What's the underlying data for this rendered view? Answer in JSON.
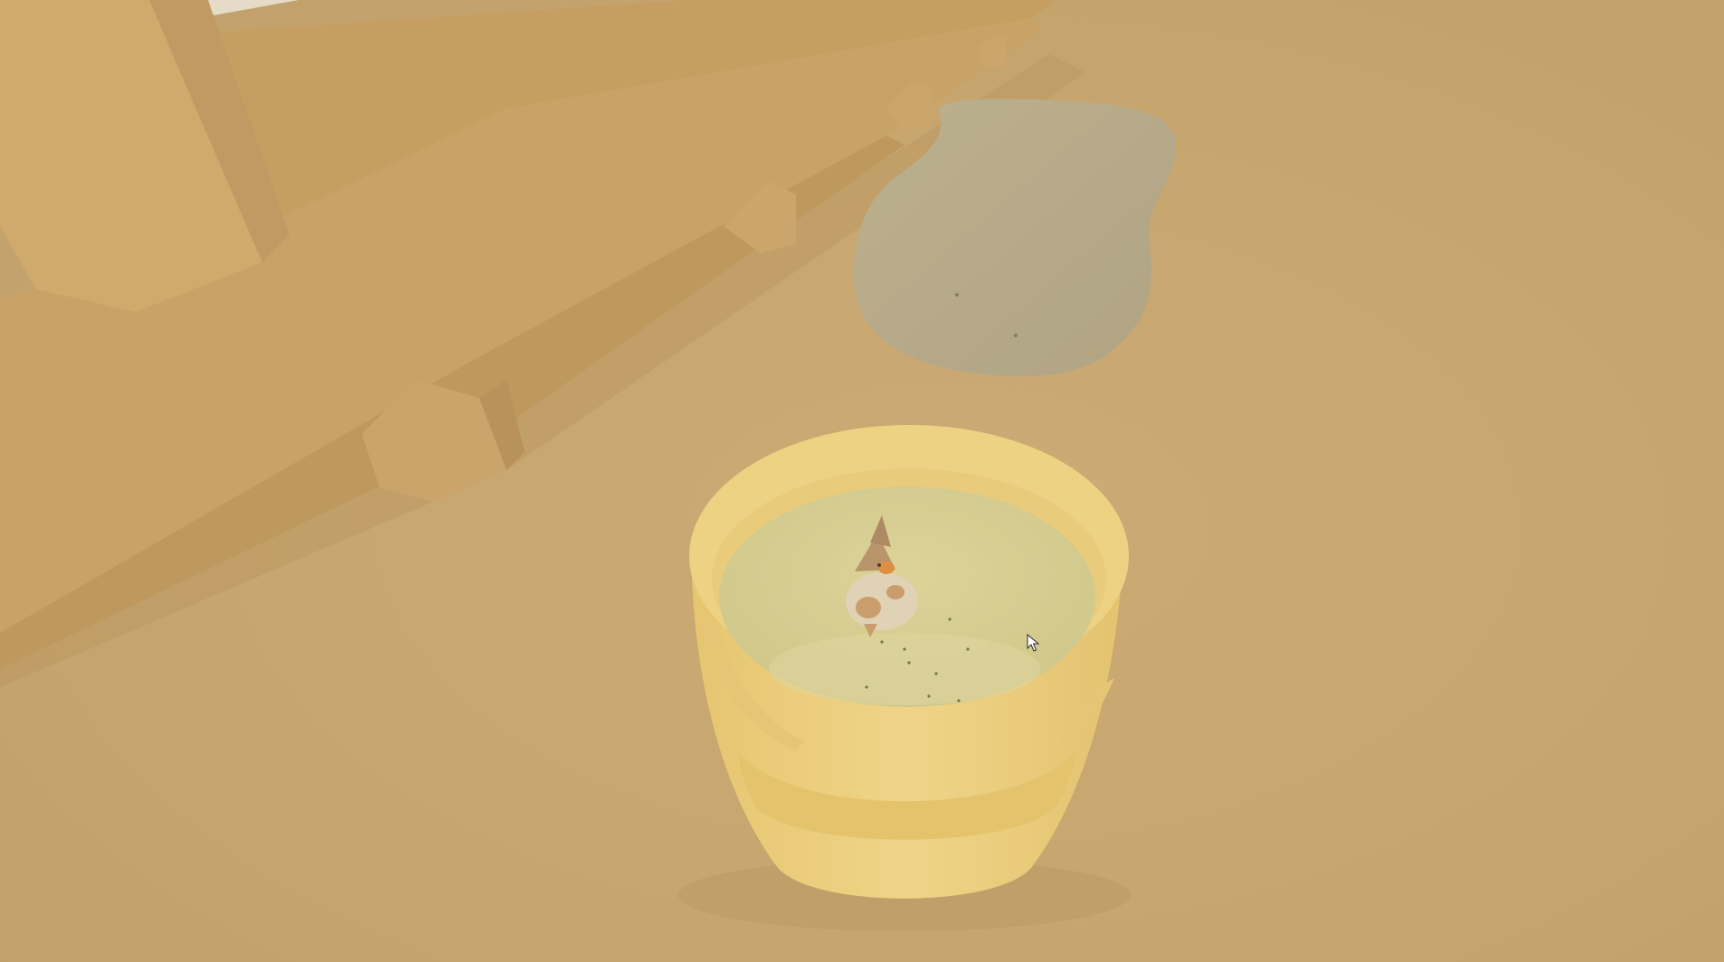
{
  "scene": {
    "description_colors": {
      "ground": "#c7a56f",
      "fence": "#c9a064",
      "fence_shadow": "#b48d57",
      "stone": "#b3aa8f",
      "bucket": "#f0d07a",
      "bucket_rim": "#f3d888",
      "water": "#d7d396",
      "goose_body": "#e9dcc4",
      "goose_accent": "#d98a3a"
    },
    "cursor_icon": "arrow-cursor-icon"
  }
}
